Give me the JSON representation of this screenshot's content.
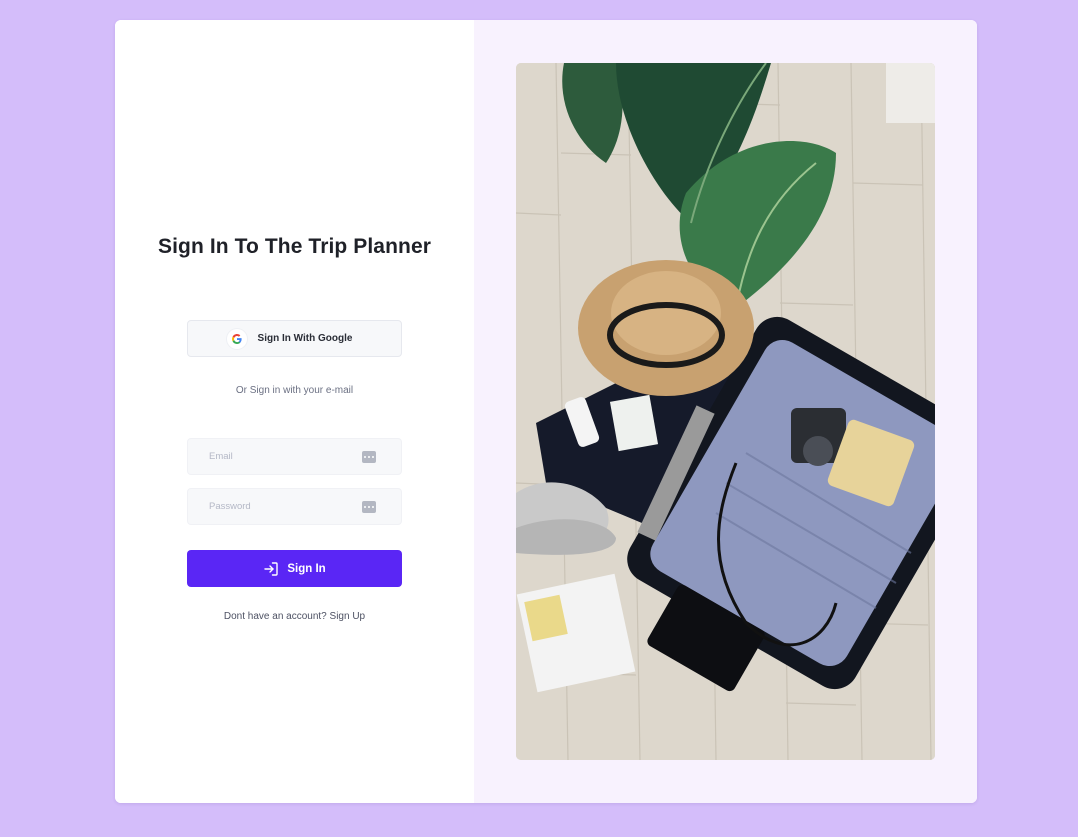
{
  "login": {
    "title": "Sign In To The Trip Planner",
    "google_button_label": "Sign In With Google",
    "or_text": "Or Sign in with your e-mail",
    "email_placeholder": "Email",
    "password_placeholder": "Password",
    "signin_button_label": "Sign In",
    "signup_prompt": "Dont have an account? ",
    "signup_link": "Sign Up"
  },
  "icons": {
    "google": "google-g-icon",
    "field_action": "dots-icon",
    "signin": "sign-in-arrow-icon"
  },
  "colors": {
    "page_background": "#d4bdfa",
    "accent": "#5a26f5",
    "panel_background": "#f8f2fe"
  }
}
